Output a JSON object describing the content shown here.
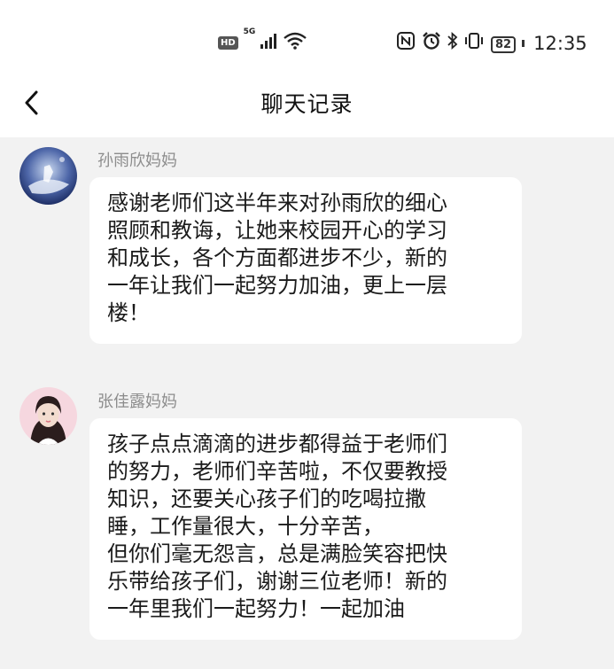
{
  "status_bar": {
    "hd_badge": "HD",
    "network_label": "5G",
    "battery": "82",
    "time": "12:35",
    "icons": [
      "hd-icon",
      "signal-icon",
      "wifi-icon",
      "nfc-icon",
      "alarm-icon",
      "bluetooth-icon",
      "vibrate-icon",
      "battery-icon"
    ]
  },
  "header": {
    "title": "聊天记录",
    "back_icon": "chevron-left-icon"
  },
  "messages": [
    {
      "sender": "孙雨欣妈妈",
      "text": "感谢老师们这半年来对孙雨欣的细心\n照顾和教诲，让她来校园开心的学习\n和成长，各个方面都进步不少，新的\n一年让我们一起努力加油，更上一层\n楼！"
    },
    {
      "sender": "张佳露妈妈",
      "text": "孩子点点滴滴的进步都得益于老师们\n的努力，老师们辛苦啦，不仅要教授\n知识，还要关心孩子们的吃喝拉撒\n睡，工作量很大，十分辛苦，\n但你们毫无怨言，总是满脸笑容把快\n乐带给孩子们，谢谢三位老师！新的\n一年里我们一起努力！一起加油"
    }
  ]
}
